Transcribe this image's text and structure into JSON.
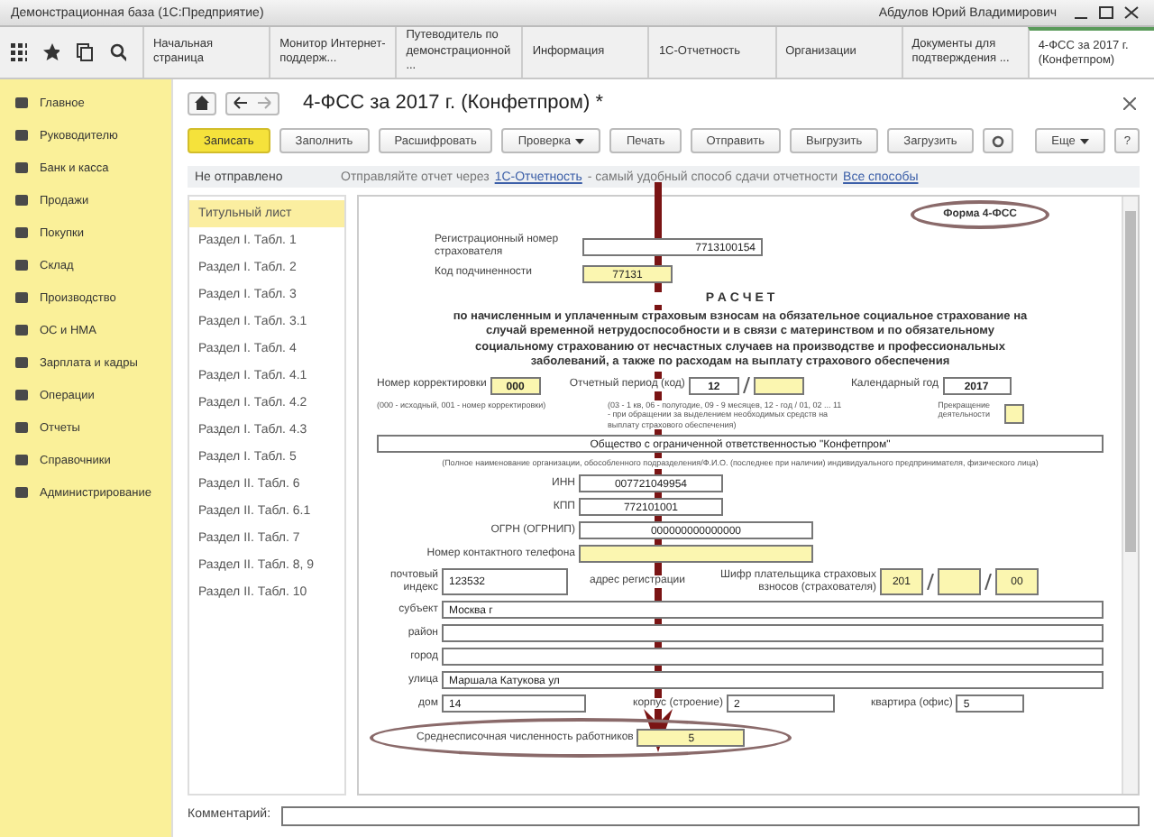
{
  "window": {
    "title": "Демонстрационная база (1С:Предприятие)",
    "user": "Абдулов Юрий Владимирович"
  },
  "tabs": [
    {
      "label": "Начальная страница",
      "selected": false
    },
    {
      "label": "Монитор Интернет-поддерж...",
      "selected": false
    },
    {
      "label": "Путеводитель по демонстрационной ...",
      "selected": false
    },
    {
      "label": "Информация",
      "selected": false
    },
    {
      "label": "1С-Отчетность",
      "selected": false
    },
    {
      "label": "Организации",
      "selected": false
    },
    {
      "label": "Документы для подтверждения ...",
      "selected": false
    },
    {
      "label": "4-ФСС за 2017 г. (Конфетпром)",
      "selected": true
    }
  ],
  "sidebar": {
    "items": [
      "Главное",
      "Руководителю",
      "Банк и касса",
      "Продажи",
      "Покупки",
      "Склад",
      "Производство",
      "ОС и НМА",
      "Зарплата и кадры",
      "Операции",
      "Отчеты",
      "Справочники",
      "Администрирование"
    ]
  },
  "document": {
    "title": "4-ФСС за 2017 г. (Конфетпром) *",
    "toolbar": [
      {
        "label": "Записать",
        "primary": true,
        "dropdown": false
      },
      {
        "label": "Заполнить",
        "primary": false,
        "dropdown": false
      },
      {
        "label": "Расшифровать",
        "primary": false,
        "dropdown": false
      },
      {
        "label": "Проверка",
        "primary": false,
        "dropdown": true
      },
      {
        "label": "Печать",
        "primary": false,
        "dropdown": false
      },
      {
        "label": "Отправить",
        "primary": false,
        "dropdown": false
      },
      {
        "label": "Выгрузить",
        "primary": false,
        "dropdown": false
      },
      {
        "label": "Загрузить",
        "primary": false,
        "dropdown": false
      }
    ],
    "more": "Еще",
    "help": "?"
  },
  "info_bar": {
    "status": "Не отправлено",
    "message": "Отправляйте отчет через",
    "link": "1С-Отчетность",
    "message_end": "- самый удобный способ сдачи отчетности",
    "link_all": "Все способы"
  },
  "sections": [
    {
      "label": "Титульный лист",
      "selected": true
    },
    {
      "label": "Раздел I. Табл. 1",
      "selected": false
    },
    {
      "label": "Раздел I. Табл. 2",
      "selected": false
    },
    {
      "label": "Раздел I. Табл. 3",
      "selected": false
    },
    {
      "label": "Раздел I. Табл. 3.1",
      "selected": false
    },
    {
      "label": "Раздел I. Табл. 4",
      "selected": false
    },
    {
      "label": "Раздел I. Табл. 4.1",
      "selected": false
    },
    {
      "label": "Раздел I. Табл. 4.2",
      "selected": false
    },
    {
      "label": "Раздел I. Табл. 4.3",
      "selected": false
    },
    {
      "label": "Раздел I. Табл. 5",
      "selected": false
    },
    {
      "label": "Раздел II. Табл. 6",
      "selected": false
    },
    {
      "label": "Раздел II. Табл. 6.1",
      "selected": false
    },
    {
      "label": "Раздел II. Табл. 7",
      "selected": false
    },
    {
      "label": "Раздел II. Табл. 8, 9",
      "selected": false
    },
    {
      "label": "Раздел II. Табл. 10",
      "selected": false
    }
  ],
  "form": {
    "form_name": "Форма 4-ФСС",
    "reg_number": {
      "label": "Регистрационный номер страхователя",
      "value": "7713100154",
      "highlighted": false
    },
    "subordination": {
      "label": "Код подчиненности",
      "value": "77131",
      "highlighted": true
    },
    "title": "Р А С Ч Е Т",
    "description": "по начисленным и уплаченным страховым взносам на обязательное социальное страхование на случай временной нетрудоспособности и в связи с материнством и по обязательному социальному страхованию от несчастных случаев на производстве и профессиональных заболеваний, а также по расходам на выплату страхового обеспечения",
    "correction": {
      "label": "Номер корректировки",
      "value": "000",
      "highlighted": true
    },
    "period": {
      "label": "Отчетный период (код)",
      "value": "12",
      "highlighted": false
    },
    "period_extra": {
      "highlighted": true
    },
    "year": {
      "label": "Календарный год",
      "value": "2017",
      "highlighted": false
    },
    "correction_note": "(000 - исходный, 001 - номер корректировки)",
    "period_note": "(03 - 1 кв, 06 - полугодие, 09 - 9 месяцев, 12 - год / 01, 02 ... 11 - при обращении за выделением необходимых средств на выплату страхового обеспечения)",
    "termination": {
      "label": "Прекращение деятельности",
      "checked": false
    },
    "org_name": {
      "value": "Общество с ограниченной ответственностью \"Конфетпром\"",
      "highlighted": false
    },
    "org_note": "(Полное наименование организации, обособленного подразделения/Ф.И.О. (последнее при наличии) индивидуального предпринимателя, физического лица)",
    "ids": [
      {
        "label": "ИНН",
        "value": "007721049954",
        "highlighted": false
      },
      {
        "label": "КПП",
        "value": "772101001",
        "highlighted": false
      },
      {
        "label": "ОГРН (ОГРНИП)",
        "value": "000000000000000",
        "highlighted": false
      },
      {
        "label": "Номер контактного телефона",
        "highlighted": true
      }
    ],
    "postal": {
      "label": "почтовый индекс",
      "value": "123532",
      "highlighted": false
    },
    "address_label": "адрес регистрации",
    "payer_code": {
      "label": "Шифр плательщика страховых взносов (страхователя)",
      "parts": [
        {
          "value": "201",
          "highlighted": true
        },
        {
          "highlighted": true
        },
        {
          "value": "00",
          "highlighted": true
        }
      ]
    },
    "address": [
      {
        "label": "субъект",
        "value": "Москва г",
        "highlighted": false
      },
      {
        "label": "район",
        "highlighted": false
      },
      {
        "label": "город",
        "highlighted": false
      },
      {
        "label": "улица",
        "value": "Маршала Катукова ул",
        "highlighted": false
      }
    ],
    "house": {
      "label": "дом",
      "value": "14",
      "highlighted": false
    },
    "building": {
      "label": "корпус (строение)",
      "value": "2",
      "highlighted": false
    },
    "apartment": {
      "label": "квартира (офис)",
      "value": "5",
      "highlighted": false
    },
    "headcount": {
      "label": "Среднесписочная численность работников",
      "value": "5",
      "highlighted": true
    }
  },
  "comment": {
    "label": "Комментарий:"
  }
}
